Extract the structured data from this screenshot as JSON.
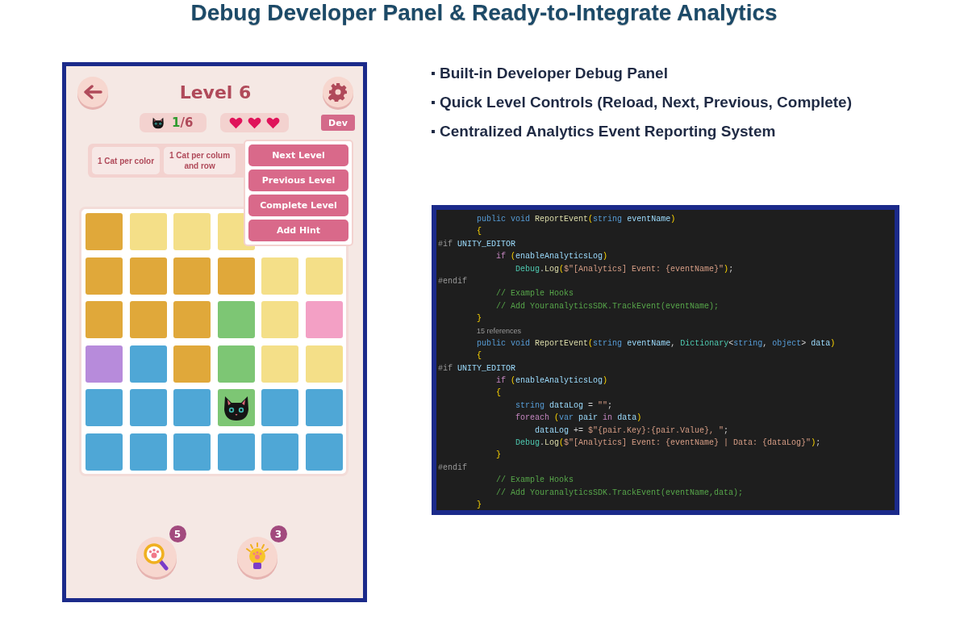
{
  "title": "Debug Developer Panel & Ready-to-Integrate Analytics",
  "features": [
    "Built-in Developer Debug Panel",
    "Quick Level Controls (Reload, Next, Previous, Complete)",
    "Centralized Analytics Event Reporting System"
  ],
  "game": {
    "level_title": "Level 6",
    "cats_found": "1",
    "cats_total": "/6",
    "lives": [
      {
        "kind": "heart"
      },
      {
        "kind": "heart"
      },
      {
        "kind": "heart"
      }
    ],
    "dev_button": "Dev",
    "rules": [
      "1 Cat per color",
      "1 Cat per colum\nand row"
    ],
    "debug_menu": [
      "Next Level",
      "Previous Level",
      "Complete Level",
      "Add Hint"
    ],
    "grid": [
      [
        {
          "color": "#e0a83a"
        },
        {
          "color": "#f4df88"
        },
        {
          "color": "#f4df88"
        },
        {
          "color": "#f4df88"
        }
      ],
      [
        {
          "color": "#e0a83a"
        },
        {
          "color": "#e0a83a"
        },
        {
          "color": "#e0a83a"
        },
        {
          "color": "#e0a83a"
        },
        {
          "color": "#f4df88"
        },
        {
          "color": "#f4df88"
        }
      ],
      [
        {
          "color": "#e0a83a"
        },
        {
          "color": "#e0a83a"
        },
        {
          "color": "#e0a83a"
        },
        {
          "color": "#7dc674"
        },
        {
          "color": "#f4df88"
        },
        {
          "color": "#f3a0c5"
        }
      ],
      [
        {
          "color": "#b78bdb"
        },
        {
          "color": "#4fa7d6"
        },
        {
          "color": "#e0a83a"
        },
        {
          "color": "#7dc674"
        },
        {
          "color": "#f4df88"
        },
        {
          "color": "#f4df88"
        }
      ],
      [
        {
          "color": "#4fa7d6"
        },
        {
          "color": "#4fa7d6"
        },
        {
          "color": "#4fa7d6"
        },
        {
          "color": "#7dc674",
          "kind": "cat"
        },
        {
          "color": "#4fa7d6"
        },
        {
          "color": "#4fa7d6"
        }
      ],
      [
        {
          "color": "#4fa7d6"
        },
        {
          "color": "#4fa7d6"
        },
        {
          "color": "#4fa7d6"
        },
        {
          "color": "#4fa7d6"
        },
        {
          "color": "#4fa7d6"
        },
        {
          "color": "#4fa7d6"
        }
      ]
    ],
    "tools": [
      {
        "kind": "magnifier",
        "badge": "5"
      },
      {
        "kind": "bulb",
        "badge": "3"
      }
    ]
  },
  "code": {
    "lines": [
      {
        "kind": "l2",
        "text": "public void ReportEvent(string eventName)"
      },
      {
        "kind": "l2",
        "text": "{"
      },
      {
        "kind": "l0",
        "text": "#if UNITY_EDITOR"
      },
      {
        "kind": "l3",
        "text": "if (enableAnalyticsLog)"
      },
      {
        "kind": "l4",
        "text": "Debug.Log($\"[Analytics] Event: {eventName}\");"
      },
      {
        "kind": "l0",
        "text": "#endif"
      },
      {
        "kind": "l3",
        "text": "// Example Hooks"
      },
      {
        "kind": "l3",
        "text": "// Add YouranalyticsSDK.TrackEvent(eventName);"
      },
      {
        "kind": "l2",
        "text": "}"
      },
      {
        "kind": "meta",
        "text": "15 references"
      },
      {
        "kind": "l2",
        "text": "public void ReportEvent(string eventName, Dictionary<string, object> data)"
      },
      {
        "kind": "l2",
        "text": "{"
      },
      {
        "kind": "l0",
        "text": "#if UNITY_EDITOR"
      },
      {
        "kind": "l3",
        "text": "if (enableAnalyticsLog)"
      },
      {
        "kind": "l3",
        "text": "{"
      },
      {
        "kind": "l4",
        "text": "string dataLog = \"\";"
      },
      {
        "kind": "l4",
        "text": "foreach (var pair in data)"
      },
      {
        "kind": "l5",
        "text": "dataLog += $\"{pair.Key}:{pair.Value}, \";"
      },
      {
        "kind": "l4",
        "text": "Debug.Log($\"[Analytics] Event: {eventName} | Data: {dataLog}\");"
      },
      {
        "kind": "l3",
        "text": "}"
      },
      {
        "kind": "l0",
        "text": "#endif"
      },
      {
        "kind": "l3",
        "text": "// Example Hooks"
      },
      {
        "kind": "l3",
        "text": "// Add YouranalyticsSDK.TrackEvent(eventName,data);"
      },
      {
        "kind": "l2",
        "text": "}"
      }
    ]
  }
}
